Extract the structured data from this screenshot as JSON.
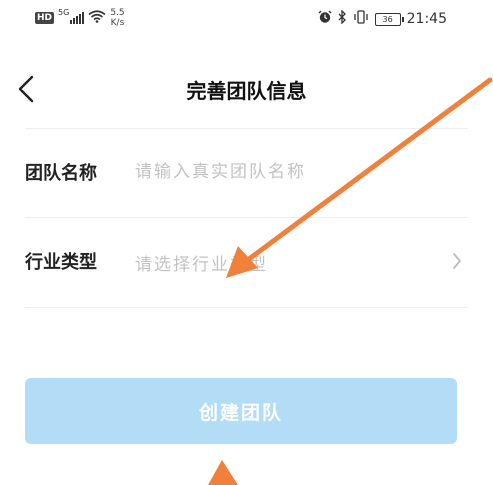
{
  "status_bar": {
    "network_badge": "HD",
    "network_type": "5G",
    "speed_value": "5.5",
    "speed_unit": "K/s",
    "battery": "36",
    "time": "21:45"
  },
  "nav": {
    "title": "完善团队信息"
  },
  "form": {
    "team_name": {
      "label": "团队名称",
      "placeholder": "请输入真实团队名称",
      "value": ""
    },
    "industry": {
      "label": "行业类型",
      "placeholder": "请选择行业类型"
    }
  },
  "actions": {
    "create_label": "创建团队"
  },
  "colors": {
    "primary_button_disabled": "#b3ddf7",
    "placeholder": "#c2c2c2",
    "annotation_arrow": "#f0803a"
  }
}
